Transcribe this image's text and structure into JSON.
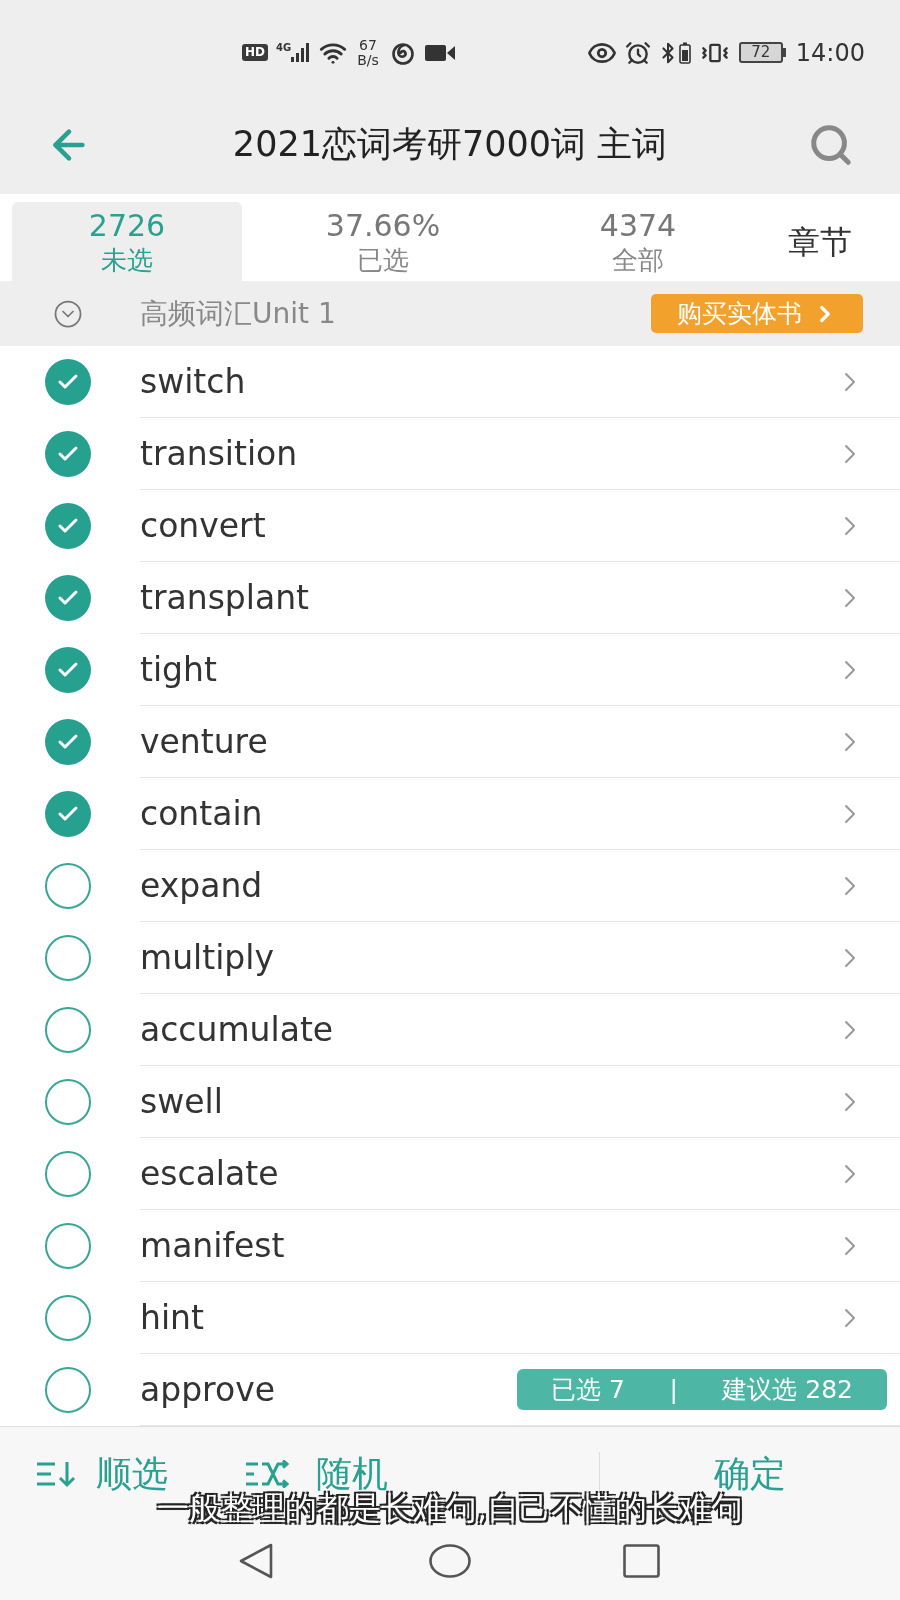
{
  "status_bar": {
    "hd": "HD",
    "network": "4G",
    "speed_value": "67",
    "speed_unit": "B/s",
    "battery": "72",
    "time": "14:00"
  },
  "header": {
    "title": "2021恋词考研7000词 主词"
  },
  "tabs": [
    {
      "kind": "stat",
      "value": "2726",
      "label": "未选",
      "selected": true
    },
    {
      "kind": "stat",
      "value": "37.66%",
      "label": "已选",
      "selected": false
    },
    {
      "kind": "stat",
      "value": "4374",
      "label": "全部",
      "selected": false
    },
    {
      "kind": "plain",
      "label": "章节",
      "selected": false
    }
  ],
  "section": {
    "title": "高频词汇Unit 1",
    "buy_button": "购买实体书"
  },
  "words": [
    {
      "word": "switch",
      "checked": true
    },
    {
      "word": "transition",
      "checked": true
    },
    {
      "word": "convert",
      "checked": true
    },
    {
      "word": "transplant",
      "checked": true
    },
    {
      "word": "tight",
      "checked": true
    },
    {
      "word": "venture",
      "checked": true
    },
    {
      "word": "contain",
      "checked": true
    },
    {
      "word": "expand",
      "checked": false
    },
    {
      "word": "multiply",
      "checked": false
    },
    {
      "word": "accumulate",
      "checked": false
    },
    {
      "word": "swell",
      "checked": false
    },
    {
      "word": "escalate",
      "checked": false
    },
    {
      "word": "manifest",
      "checked": false
    },
    {
      "word": "hint",
      "checked": false
    },
    {
      "word": "approve",
      "checked": false
    }
  ],
  "selection_pill": {
    "selected_text": "已选 7",
    "separator": "|",
    "suggest_text": "建议选 282"
  },
  "bottom_bar": {
    "actions": [
      {
        "kind": "sequential",
        "label": "顺选"
      },
      {
        "kind": "random",
        "label": "随机"
      }
    ],
    "confirm": "确定"
  },
  "subtitle": "一般整理的都是长难句,自己不懂的长难句"
}
